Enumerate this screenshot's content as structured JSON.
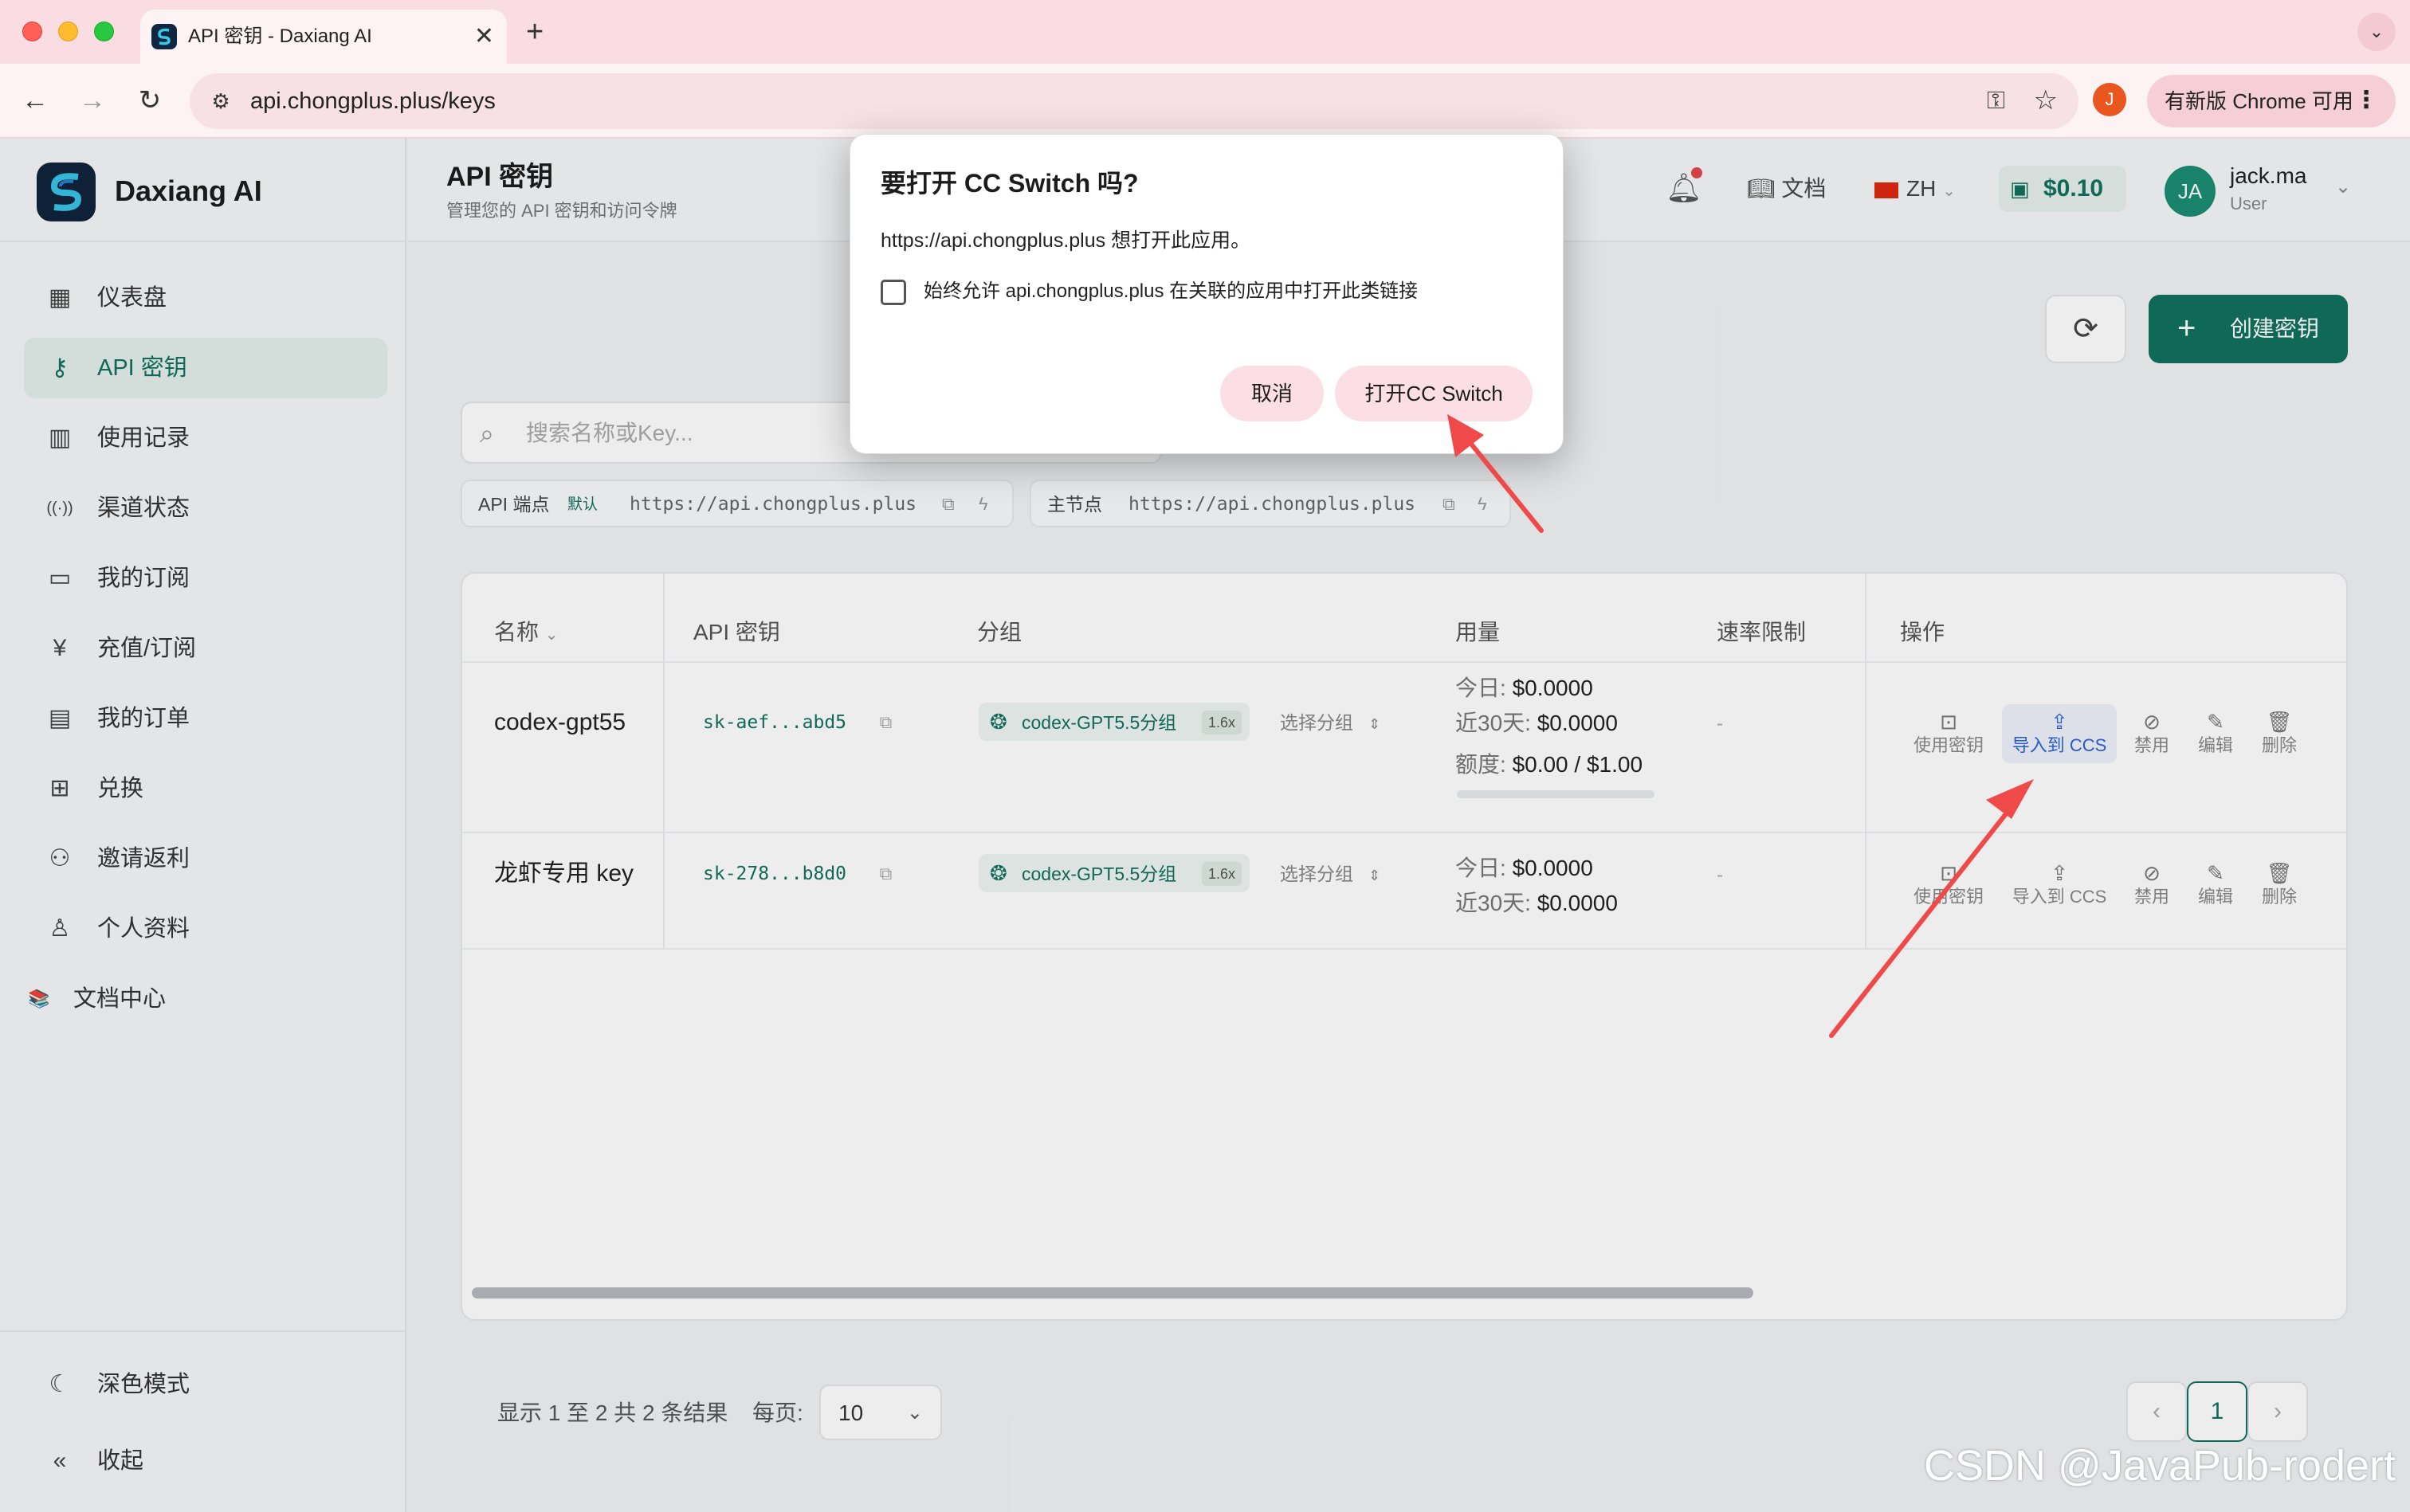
{
  "browser": {
    "tab_title": "API 密钥 - Daxiang AI",
    "tab_close": "✕",
    "new_tab": "+",
    "tablist": "⌄",
    "url": "api.chongplus.plus/keys",
    "profile_initial": "J",
    "update_label": "有新版 Chrome 可用",
    "menu_glyph": "⋮"
  },
  "sidebar": {
    "brand": "Daxiang AI",
    "items": [
      {
        "label": "仪表盘",
        "icon": "dashboard-icon",
        "glyph": "▦"
      },
      {
        "label": "API 密钥",
        "icon": "key-icon",
        "glyph": "⚷"
      },
      {
        "label": "使用记录",
        "icon": "bar-chart-icon",
        "glyph": "▥"
      },
      {
        "label": "渠道状态",
        "icon": "signal-icon",
        "glyph": "((·))"
      },
      {
        "label": "我的订阅",
        "icon": "card-icon",
        "glyph": "▭"
      },
      {
        "label": "充值/订阅",
        "icon": "yen-icon",
        "glyph": "¥"
      },
      {
        "label": "我的订单",
        "icon": "document-icon",
        "glyph": "▤"
      },
      {
        "label": "兑换",
        "icon": "gift-icon",
        "glyph": "⊞"
      },
      {
        "label": "邀请返利",
        "icon": "users-icon",
        "glyph": "⚇"
      },
      {
        "label": "个人资料",
        "icon": "user-icon",
        "glyph": "♙"
      },
      {
        "label": "文档中心",
        "icon": "books-icon",
        "glyph": "📚"
      }
    ],
    "dark_mode": "深色模式",
    "collapse": "收起"
  },
  "header": {
    "title": "API 密钥",
    "subtitle": "管理您的 API 密钥和访问令牌",
    "docs": "文档",
    "lang": "ZH",
    "balance": "$0.10",
    "avatar": "JA",
    "user": "jack.ma",
    "role": "User"
  },
  "toolbar": {
    "create": "创建密钥",
    "search_placeholder": "搜索名称或Key..."
  },
  "endpoints": [
    {
      "label": "API 端点",
      "badge": "默认",
      "url": "https://api.chongplus.plus"
    },
    {
      "label": "主节点",
      "badge": "",
      "url": "https://api.chongplus.plus"
    }
  ],
  "table": {
    "headers": [
      "名称",
      "API 密钥",
      "分组",
      "用量",
      "速率限制",
      "操作"
    ],
    "rows": [
      {
        "name": "codex-gpt55",
        "key": "sk-aef...abd5",
        "group": "codex-GPT5.5分组",
        "multiplier": "1.6x",
        "group_select": "选择分组",
        "today_label": "今日:",
        "today": "$0.0000",
        "d30_label": "近30天:",
        "d30": "$0.0000",
        "quota_label": "额度:",
        "quota": "$0.00 / $1.00",
        "rate": "-"
      },
      {
        "name": "龙虾专用 key",
        "key": "sk-278...b8d0",
        "group": "codex-GPT5.5分组",
        "multiplier": "1.6x",
        "group_select": "选择分组",
        "today_label": "今日:",
        "today": "$0.0000",
        "d30_label": "近30天:",
        "d30": "$0.0000",
        "rate": "-"
      }
    ],
    "actions": [
      "使用密钥",
      "导入到 CCS",
      "禁用",
      "编辑",
      "删除"
    ]
  },
  "pager": {
    "summary": "显示 1 至 2 共 2 条结果",
    "per_page_label": "每页:",
    "per_page": "10",
    "current": "1"
  },
  "dialog": {
    "title": "要打开 CC Switch 吗?",
    "message": "https://api.chongplus.plus 想打开此应用。",
    "checkbox_label": "始终允许 api.chongplus.plus 在关联的应用中打开此类链接",
    "cancel": "取消",
    "open": "打开CC Switch"
  },
  "watermark": "CSDN @JavaPub-rodert",
  "colors": {
    "accent": "#12705e",
    "arrow": "#f0494a",
    "link_highlight": "#2b63d6"
  }
}
